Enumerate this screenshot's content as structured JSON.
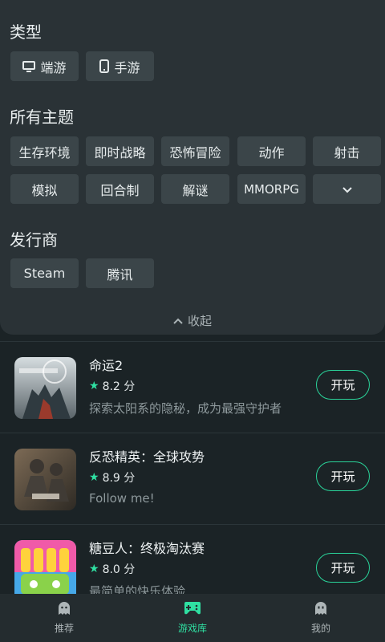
{
  "filters": {
    "type_title": "类型",
    "types": [
      {
        "label": "端游",
        "icon": "desktop-icon"
      },
      {
        "label": "手游",
        "icon": "phone-icon"
      }
    ],
    "theme_title": "所有主题",
    "themes_row1": [
      "生存环境",
      "即时战略",
      "恐怖冒险",
      "动作",
      "射击"
    ],
    "themes_row2": [
      "模拟",
      "回合制",
      "解谜",
      "MMORPG"
    ],
    "expand_icon": "chevron-down-icon",
    "publisher_title": "发行商",
    "publishers": [
      "Steam",
      "腾讯"
    ],
    "collapse_label": "收起"
  },
  "games": [
    {
      "name": "命运2",
      "rating": "8.2 分",
      "desc": "探索太阳系的隐秘，成为最强守护者",
      "play": "开玩"
    },
    {
      "name": "反恐精英：全球攻势",
      "rating": "8.9 分",
      "desc": "Follow me!",
      "play": "开玩"
    },
    {
      "name": "糖豆人：终极淘汰赛",
      "rating": "8.0 分",
      "desc": "最简单的快乐体验",
      "play": "开玩"
    }
  ],
  "nav": [
    {
      "label": "推荐",
      "icon": "ghost-icon",
      "active": false
    },
    {
      "label": "游戏库",
      "icon": "gamepad-icon",
      "active": true
    },
    {
      "label": "我的",
      "icon": "profile-ghost-icon",
      "active": false
    }
  ],
  "colors": {
    "accent": "#2fe0a2",
    "panel": "#2a3236",
    "chip": "#3b4549",
    "background": "#1b2326"
  }
}
